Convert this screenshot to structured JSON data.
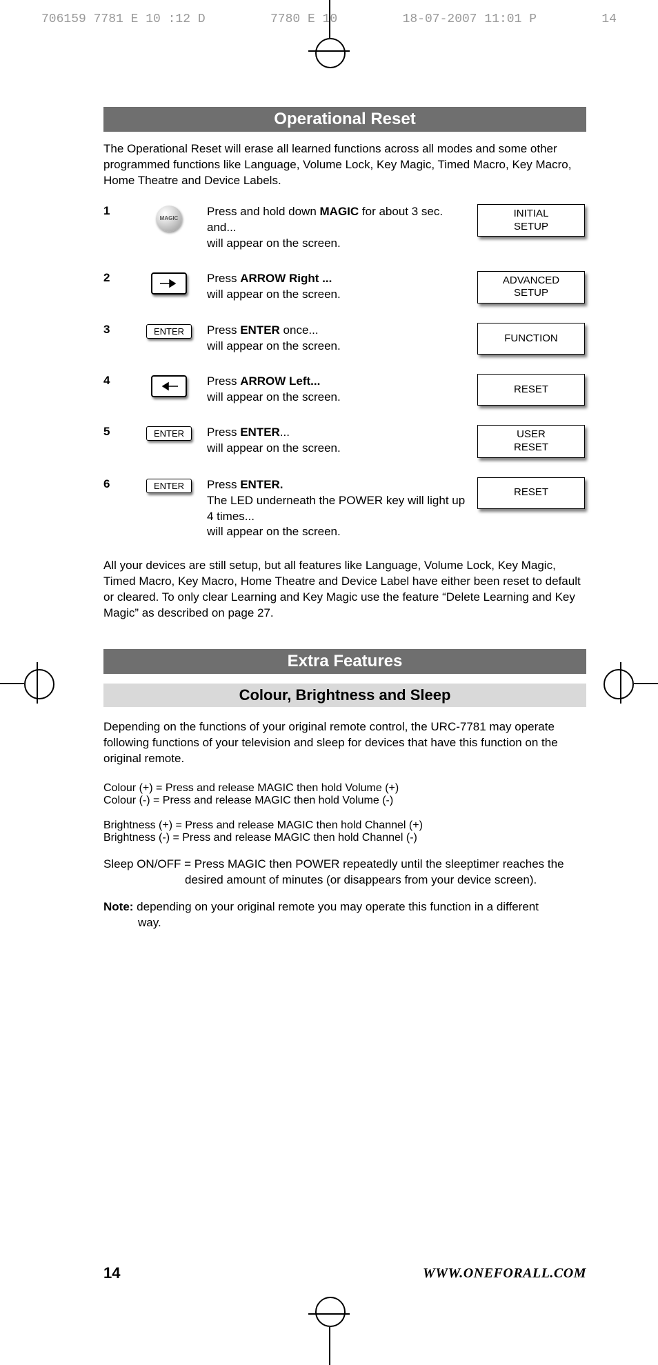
{
  "slug": {
    "left": "706159 7781 E 10 :12 D",
    "mid": "7780 E   10",
    "date": "18-07-2007  11:01  P",
    "pg": "14"
  },
  "title1": "Operational Reset",
  "intro": "The Operational Reset will erase all learned functions across all modes and some other programmed functions like Language, Volume Lock, Key Magic, Timed Macro, Key Macro, Home Theatre and Device Labels.",
  "steps": [
    {
      "num": "1",
      "btn": "magic",
      "text_pre": "Press and hold down ",
      "bold": "MAGIC",
      "text_post": " for about 3 sec. and...\nwill appear on the screen.",
      "lcd": "INITIAL\nSETUP"
    },
    {
      "num": "2",
      "btn": "arrow-right",
      "text_pre": "Press ",
      "bold": "ARROW Right ...",
      "text_post": "\nwill appear on the screen.",
      "lcd": "ADVANCED\nSETUP"
    },
    {
      "num": "3",
      "btn": "enter",
      "enter_label": "ENTER",
      "text_pre": "Press ",
      "bold": "ENTER",
      "text_post": " once...\nwill appear on the screen.",
      "lcd": "FUNCTION"
    },
    {
      "num": "4",
      "btn": "arrow-left",
      "text_pre": "Press ",
      "bold": "ARROW Left...",
      "text_post": "\nwill appear on the screen.",
      "lcd": "RESET"
    },
    {
      "num": "5",
      "btn": "enter",
      "enter_label": "ENTER",
      "text_pre": "Press ",
      "bold": "ENTER",
      "text_post": "...\nwill appear on the screen.",
      "lcd": "USER\nRESET"
    },
    {
      "num": "6",
      "btn": "enter",
      "enter_label": "ENTER",
      "text_pre": "Press ",
      "bold": "ENTER.",
      "text_post": "\nThe LED underneath the POWER key will light up 4 times...\nwill appear on the screen.",
      "lcd": "RESET"
    }
  ],
  "after_steps": "All your devices are still setup, but all features like Language, Volume Lock, Key Magic, Timed Macro, Key Macro, Home Theatre and Device Label have either been reset to default or cleared. To only clear Learning and Key Magic use the feature “Delete Learning and Key Magic” as described on page 27.",
  "title2": "Extra Features",
  "title3": "Colour, Brightness and Sleep",
  "extra_intro": "Depending on the functions of your original remote control, the URC-7781 may operate following functions of your television and sleep for devices that have this function on the original remote.",
  "colour_plus": "Colour (+) = Press and release MAGIC then hold Volume (+)",
  "colour_minus": "Colour (-) = Press and release MAGIC then hold Volume (-)",
  "bright_plus": "Brightness (+) = Press and release MAGIC then hold Channel (+)",
  "bright_minus": "Brightness (-) = Press and release MAGIC then hold Channel (-)",
  "sleep_line1": "Sleep ON/OFF = Press MAGIC then POWER repeatedly until the sleeptimer reaches the",
  "sleep_line2": "desired amount of minutes (or disappears from your device screen).",
  "note_bold": "Note:",
  "note_line1": " depending on your original remote you may operate this function in a different",
  "note_line2": "way.",
  "magic_label": "MAGIC",
  "footer": {
    "page": "14",
    "url": "WWW.ONEFORALL.COM"
  }
}
